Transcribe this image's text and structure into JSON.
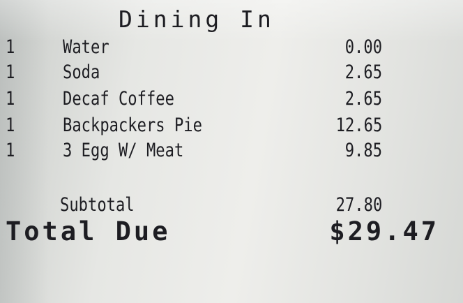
{
  "receipt": {
    "heading": "Dining In",
    "items": [
      {
        "qty": "1",
        "name": "Water",
        "price": "0.00"
      },
      {
        "qty": "1",
        "name": "Soda",
        "price": "2.65"
      },
      {
        "qty": "1",
        "name": "Decaf Coffee",
        "price": "2.65"
      },
      {
        "qty": "1",
        "name": "Backpackers Pie",
        "price": "12.65"
      },
      {
        "qty": "1",
        "name": "3 Egg W/ Meat",
        "price": "9.85"
      }
    ],
    "subtotal_label": "Subtotal",
    "subtotal_value": "27.80",
    "total_label": "Total Due",
    "total_value": "$29.47"
  }
}
